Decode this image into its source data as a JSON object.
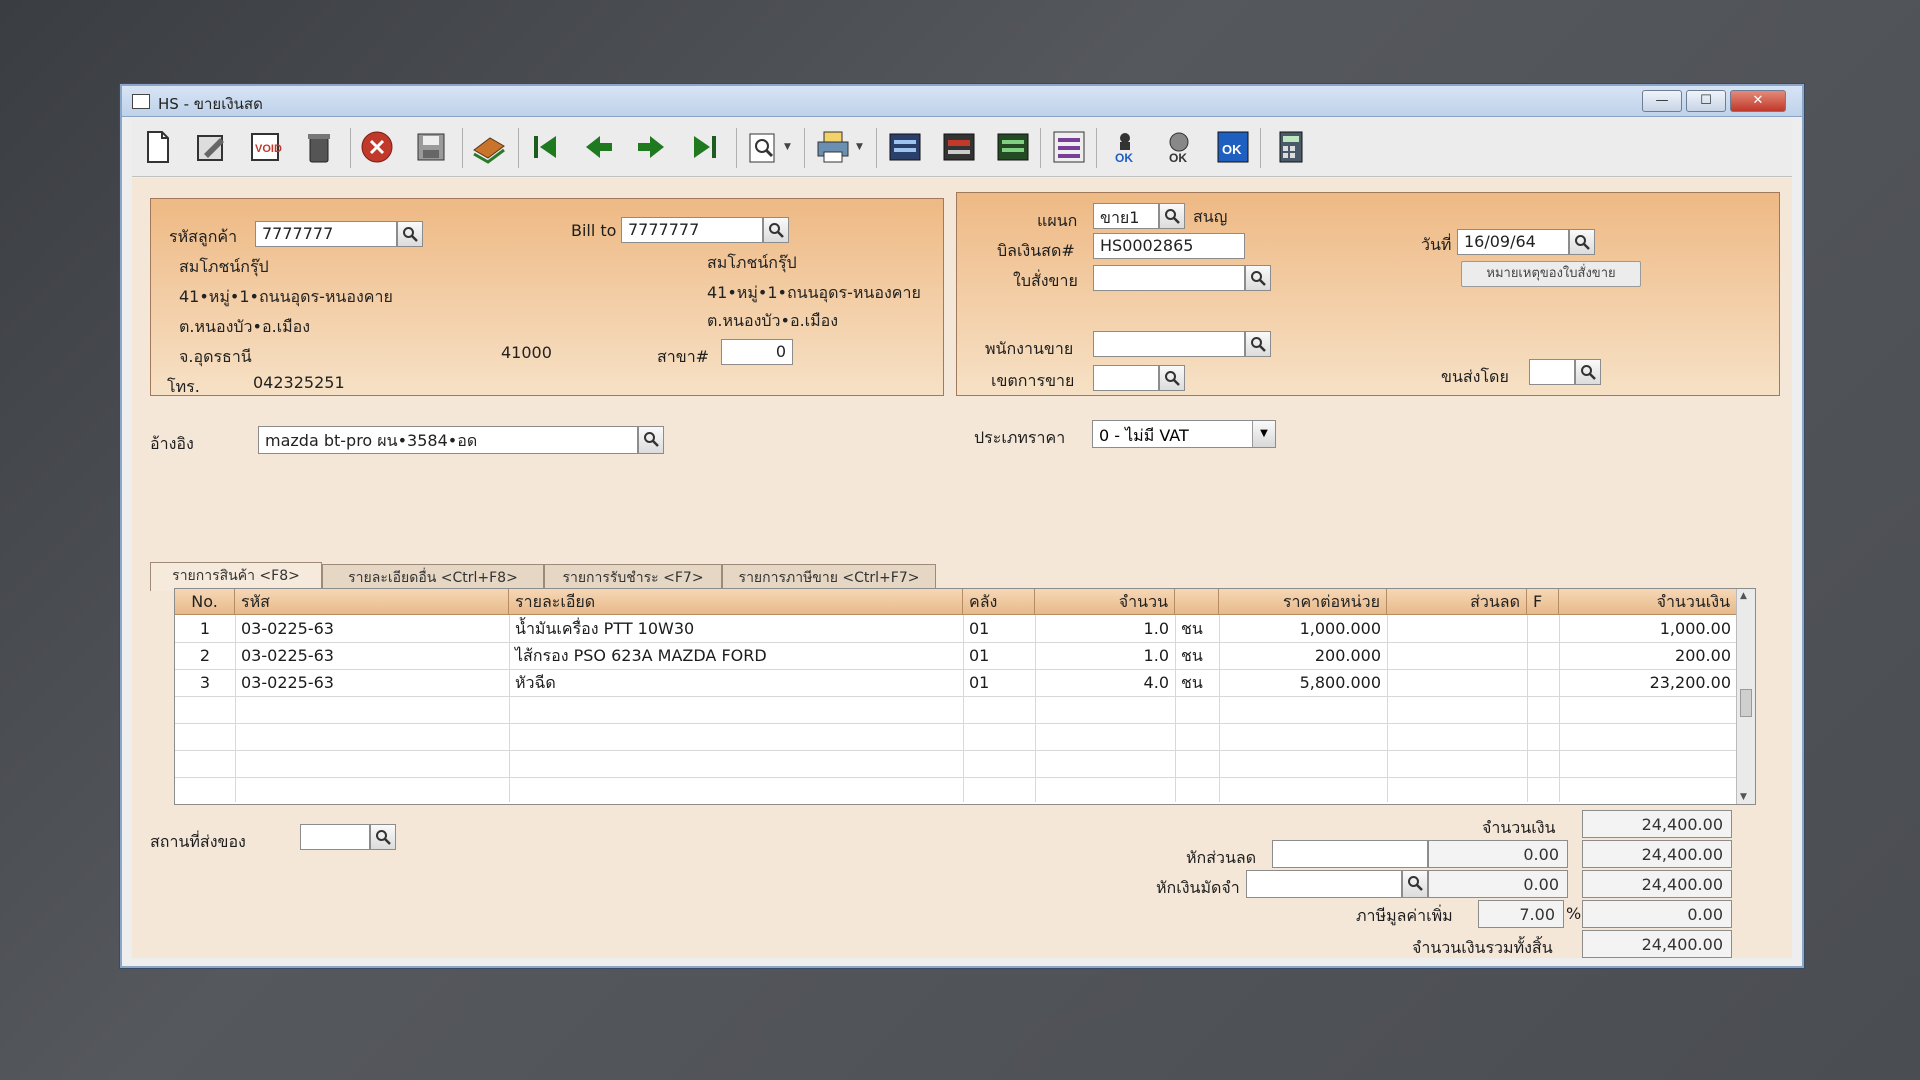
{
  "window": {
    "title": "HS - ขายเงินสด",
    "min": "—",
    "max": "☐",
    "close": "✕"
  },
  "toolbar": {
    "buttons": [
      "new-document",
      "edit",
      "void",
      "delete",
      "cancel",
      "save",
      "copy",
      "first",
      "previous",
      "next",
      "last",
      "search",
      "print",
      "view-a",
      "view-b",
      "view-c",
      "report",
      "approve-a",
      "approve-b",
      "approve-c",
      "calculator"
    ],
    "colors": {
      "cancel": "#c0392b",
      "arrow": "#1f7a1f",
      "doc": "#ffffff"
    }
  },
  "customer": {
    "code_label": "รหัสลูกค้า",
    "code": "7777777",
    "name": "สมโภชน์กรุ๊ป",
    "address1": "41•หมู่•1•ถนนอุดร-หนองคาย",
    "address2": "ต.หนองบัว•อ.เมือง",
    "province": "จ.อุดรธานี",
    "zip": "41000",
    "tel_label": "โทร.",
    "tel": "042325251",
    "ref_label": "อ้างอิง",
    "ref": "mazda bt-pro ผน•3584•อด"
  },
  "billto": {
    "label": "Bill to",
    "code": "7777777",
    "name": "สมโภชน์กรุ๊ป",
    "address1": "41•หมู่•1•ถนนอุดร-หนองคาย",
    "address2": "ต.หนองบัว•อ.เมือง",
    "branch_label": "สาขา#",
    "branch": "0"
  },
  "doc": {
    "dept_label": "แผนก",
    "dept": "ขาย1",
    "dept_name": "สนญ",
    "bill_label": "บิลเงินสด#",
    "bill_no": "HS0002865",
    "date_label": "วันที่",
    "date": "16/09/64",
    "so_label": "ใบสั่งขาย",
    "so": "",
    "note_button": "หมายเหตุของใบสั่งขาย",
    "salesman_label": "พนักงานขาย",
    "salesman": "",
    "area_label": "เขตการขาย",
    "area": "",
    "shipby_label": "ขนส่งโดย",
    "shipby": "",
    "price_type_label": "ประเภทราคา",
    "price_type": "0 - ไม่มี VAT"
  },
  "tabs": [
    "รายการสินค้า <F8>",
    "รายละเอียดอื่น <Ctrl+F8>",
    "รายการรับชำระ <F7>",
    "รายการภาษีขาย <Ctrl+F7>"
  ],
  "grid": {
    "headers": [
      "No.",
      "รหัส",
      "รายละเอียด",
      "คลัง",
      "จำนวน",
      "",
      "ราคาต่อหน่วย",
      "ส่วนลด",
      "F",
      "จำนวนเงิน"
    ],
    "rows": [
      [
        "1",
        "03-0225-63",
        "น้ำมันเครื่อง PTT 10W30",
        "01",
        "1.0",
        "ชน",
        "1,000.000",
        "",
        "",
        "1,000.00"
      ],
      [
        "2",
        "03-0225-63",
        "ไส้กรอง PSO 623A MAZDA FORD",
        "01",
        "1.0",
        "ชน",
        "200.000",
        "",
        "",
        "200.00"
      ],
      [
        "3",
        "03-0225-63",
        "หัวฉีด",
        "01",
        "4.0",
        "ชน",
        "5,800.000",
        "",
        "",
        "23,200.00"
      ]
    ]
  },
  "footer": {
    "place_label": "สถานที่ส่งของ",
    "place": "",
    "amount_label": "จำนวนเงิน",
    "amount": "24,400.00",
    "discount_label": "หักส่วนลด",
    "discount_text": "",
    "discount_val": "0.00",
    "discount_total": "24,400.00",
    "deposit_label": "หักเงินมัดจำ",
    "deposit_text": "",
    "deposit_val": "0.00",
    "deposit_total": "24,400.00",
    "vat_label": "ภาษีมูลค่าเพิ่ม",
    "vat_rate": "7.00",
    "vat_pct": "%",
    "vat_amount": "0.00",
    "grand_label": "จำนวนเงินรวมทั้งสิ้น",
    "grand_total": "24,400.00"
  }
}
